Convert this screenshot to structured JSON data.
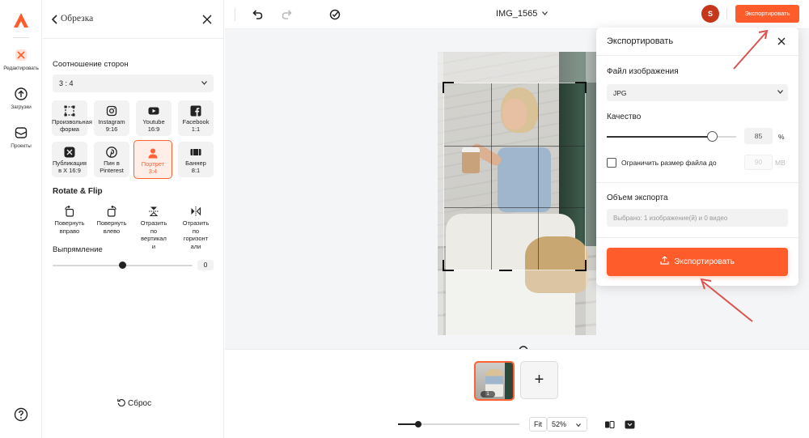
{
  "rail": {
    "items": [
      {
        "label": "Редактировать",
        "icon": "edit-icon"
      },
      {
        "label": "Загрузки",
        "icon": "upload-icon"
      },
      {
        "label": "Проекты",
        "icon": "projects-icon"
      }
    ]
  },
  "panel": {
    "title": "Обрезка",
    "aspect_label": "Соотношение сторон",
    "aspect_value": "3 : 4",
    "presets": [
      {
        "line1": "Произвольная",
        "line2": "форма",
        "icon": "freeform-icon"
      },
      {
        "line1": "Instagram",
        "line2": "9:16",
        "icon": "instagram-icon"
      },
      {
        "line1": "Youtube",
        "line2": "16:9",
        "icon": "youtube-icon"
      },
      {
        "line1": "Facebook",
        "line2": "1:1",
        "icon": "facebook-icon"
      },
      {
        "line1": "Публикация",
        "line2": "в X 16:9",
        "icon": "x-icon"
      },
      {
        "line1": "Пин в",
        "line2": "Pinterest",
        "icon": "pinterest-icon"
      },
      {
        "line1": "Портрет",
        "line2": "3:4",
        "icon": "portrait-icon",
        "active": true
      },
      {
        "line1": "Баннер",
        "line2": "8:1",
        "icon": "banner-icon"
      }
    ],
    "rotate_label": "Rotate & Flip",
    "rotate_items": [
      {
        "lines": [
          "Повернуть",
          "вправо"
        ],
        "icon": "rotate-right-icon"
      },
      {
        "lines": [
          "Повернуть",
          "влево"
        ],
        "icon": "rotate-left-icon"
      },
      {
        "lines": [
          "Отразить",
          "по",
          "вертикал",
          "и"
        ],
        "icon": "flip-vertical-icon"
      },
      {
        "lines": [
          "Отразить",
          "по",
          "горизонт",
          "али"
        ],
        "icon": "flip-horizontal-icon"
      }
    ],
    "straighten_label": "Выпрямление",
    "straighten_value": "0",
    "reset_label": "Сброс"
  },
  "topbar": {
    "filename": "IMG_1565",
    "avatar_letter": "S",
    "export_label": "Экспортировать"
  },
  "export_panel": {
    "title": "Экспортировать",
    "file_label": "Файл изображения",
    "format": "JPG",
    "quality_label": "Качество",
    "quality_value": "85",
    "quality_unit": "%",
    "quality_fraction": 0.85,
    "limit_label": "Ограничить размер файла до",
    "limit_value": "90",
    "limit_unit": "MB",
    "volume_label": "Объем экспорта",
    "summary": "Выбрано: 1 изображение(й) и 0 видео",
    "button_label": "Экспортировать"
  },
  "filmstrip": {
    "thumb_index": "1",
    "add_label": "+",
    "fit_label": "Fit",
    "zoom_value": "52%"
  },
  "colors": {
    "accent": "#ff5c2c",
    "avatar": "#c6361a",
    "arrow": "#d9534f"
  }
}
